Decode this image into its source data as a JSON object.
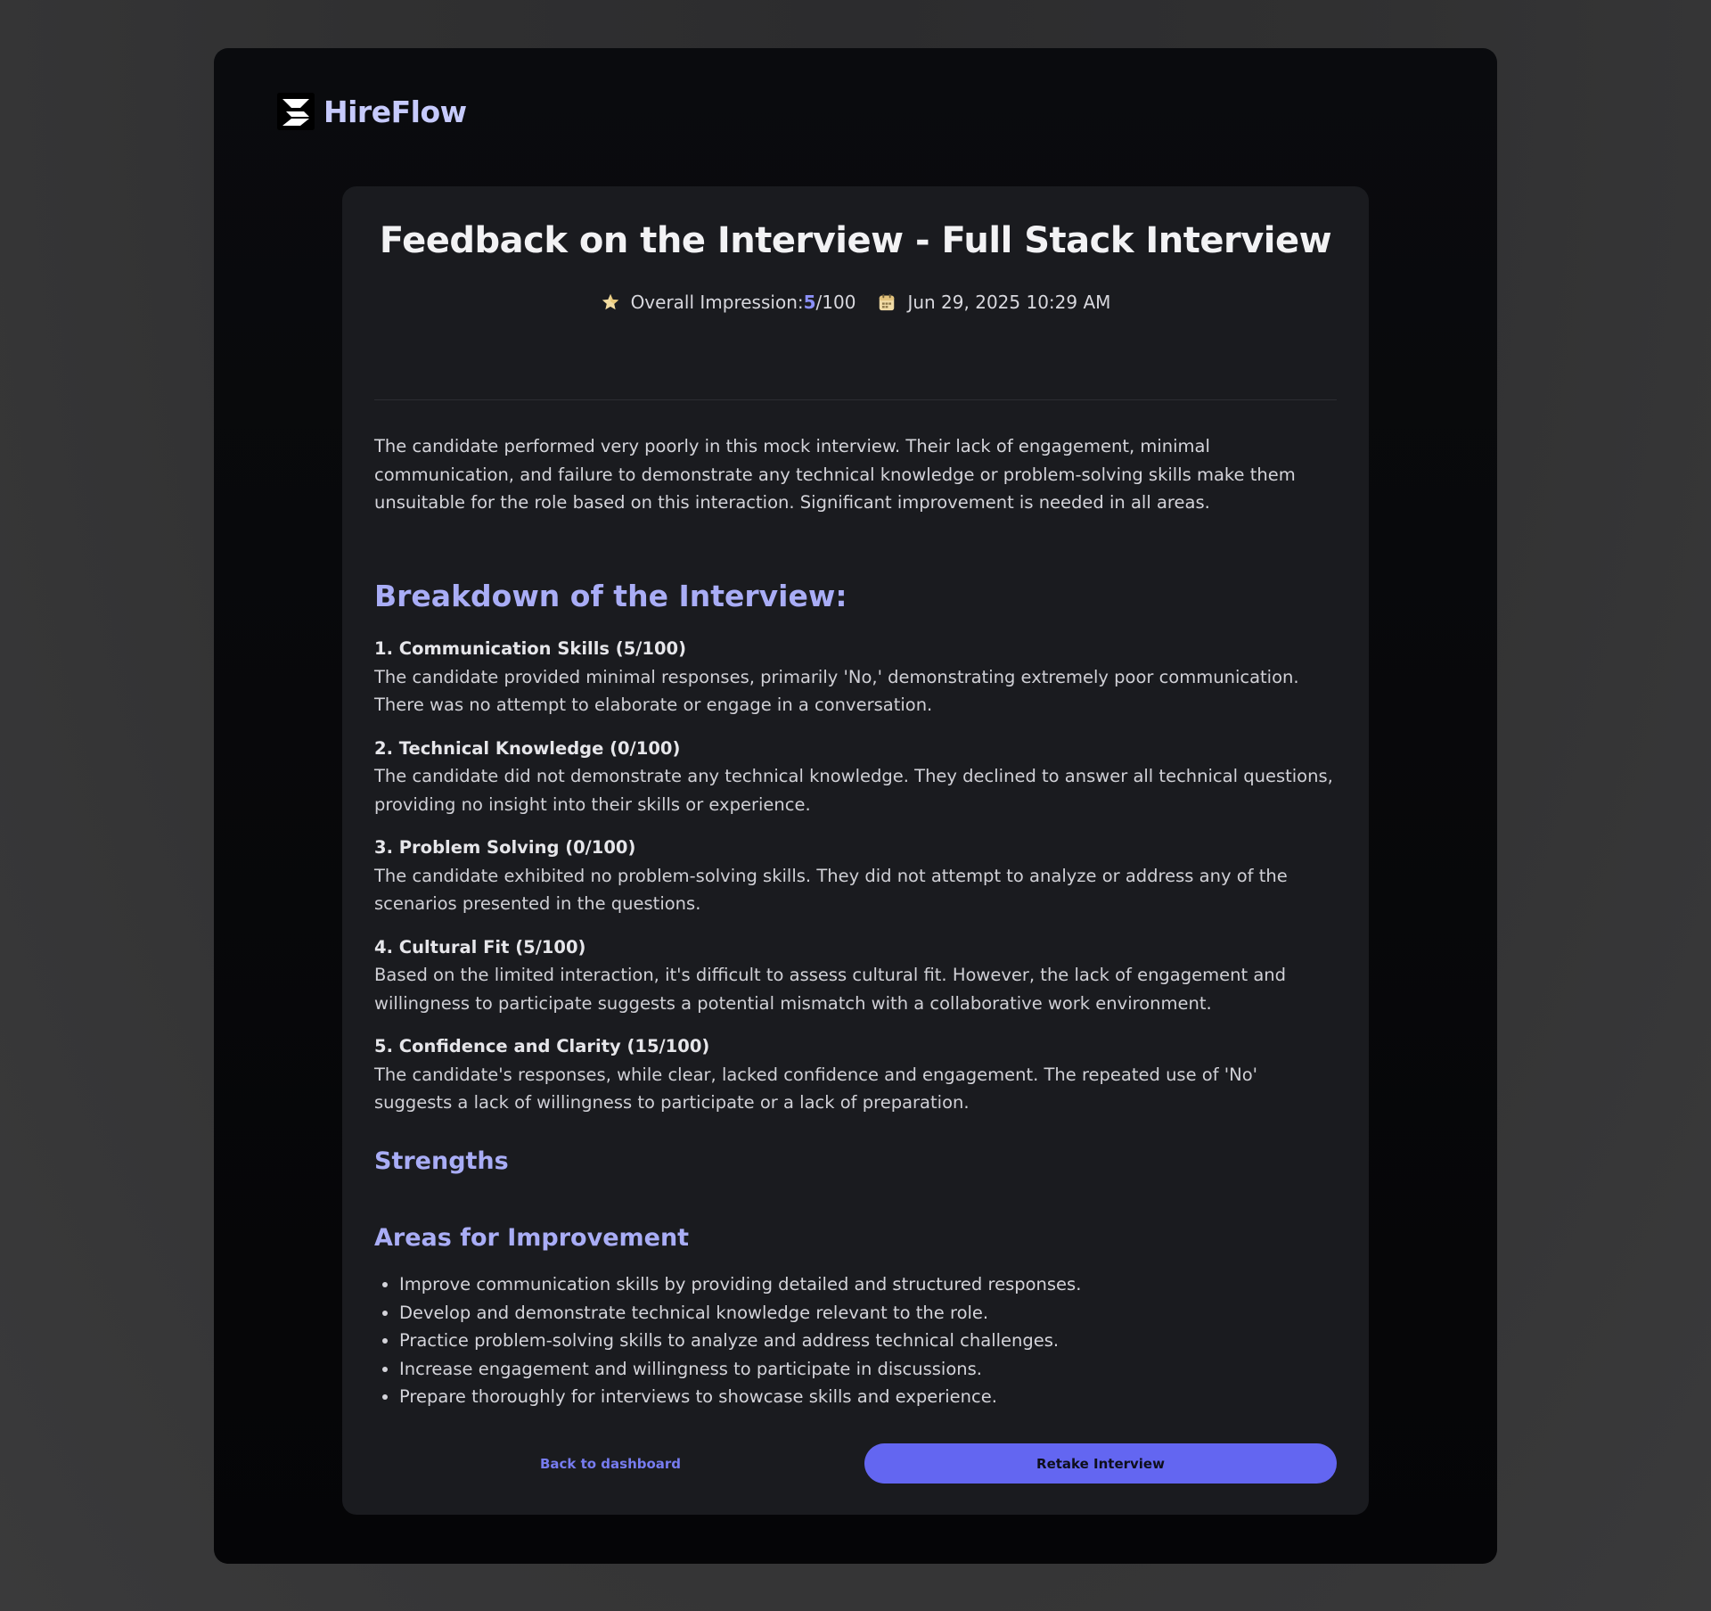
{
  "app": {
    "name": "HireFlow"
  },
  "feedback": {
    "title": "Feedback on the Interview - Full Stack Interview",
    "impression_label": "Overall Impression: ",
    "impression_score": "5",
    "impression_max": "/100",
    "date": "Jun 29, 2025 10:29 AM",
    "summary": "The candidate performed very poorly in this mock interview. Their lack of engagement, minimal communication, and failure to demonstrate any technical knowledge or problem-solving skills make them unsuitable for the role based on this interaction. Significant improvement is needed in all areas."
  },
  "breakdown": {
    "title": "Breakdown of the Interview:",
    "categories": [
      {
        "heading": "1. Communication Skills (5/100)",
        "text": "The candidate provided minimal responses, primarily 'No,' demonstrating extremely poor communication. There was no attempt to elaborate or engage in a conversation."
      },
      {
        "heading": "2. Technical Knowledge (0/100)",
        "text": "The candidate did not demonstrate any technical knowledge. They declined to answer all technical questions, providing no insight into their skills or experience."
      },
      {
        "heading": "3. Problem Solving (0/100)",
        "text": "The candidate exhibited no problem-solving skills. They did not attempt to analyze or address any of the scenarios presented in the questions."
      },
      {
        "heading": "4. Cultural Fit (5/100)",
        "text": "Based on the limited interaction, it's difficult to assess cultural fit. However, the lack of engagement and willingness to participate suggests a potential mismatch with a collaborative work environment."
      },
      {
        "heading": "5. Confidence and Clarity (15/100)",
        "text": "The candidate's responses, while clear, lacked confidence and engagement. The repeated use of 'No' suggests a lack of willingness to participate or a lack of preparation."
      }
    ]
  },
  "strengths": {
    "title": "Strengths"
  },
  "improvements": {
    "title": "Areas for Improvement",
    "items": [
      "Improve communication skills by providing detailed and structured responses.",
      "Develop and demonstrate technical knowledge relevant to the role.",
      "Practice problem-solving skills to analyze and address technical challenges.",
      "Increase engagement and willingness to participate in discussions.",
      "Prepare thoroughly for interviews to showcase skills and experience."
    ]
  },
  "actions": {
    "back_label": "Back to dashboard",
    "retake_label": "Retake Interview"
  },
  "icons": {
    "logo": "hireflow-logo-icon",
    "impression": "star-icon",
    "date": "calendar-icon"
  },
  "colors": {
    "accent": "#6366f1",
    "accent_light": "#a9adf6",
    "card": "#1a1b1f",
    "window": "#0a0b0e",
    "star": "#f3dca0"
  }
}
